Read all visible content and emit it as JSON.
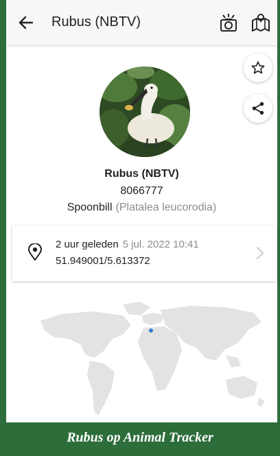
{
  "header": {
    "title": "Rubus (NBTV)",
    "back_icon": "arrow-left-icon",
    "actions": [
      "camera-flash-icon",
      "map-icon"
    ]
  },
  "floating_actions": [
    "star-icon",
    "share-icon"
  ],
  "profile": {
    "name": "Rubus (NBTV)",
    "tag_id": "8066777",
    "species_common": "Spoonbill",
    "species_latin": "(Platalea leucorodia)"
  },
  "last_location": {
    "relative_time": "2 uur geleden",
    "timestamp": "5 jul. 2022 10:41",
    "coordinates": "51.949001/5.613372"
  },
  "caption": "Rubus op Animal Tracker",
  "colors": {
    "border_green": "#2c6d3a",
    "map_land": "#e3e3e3",
    "marker": "#2f7fd0"
  }
}
